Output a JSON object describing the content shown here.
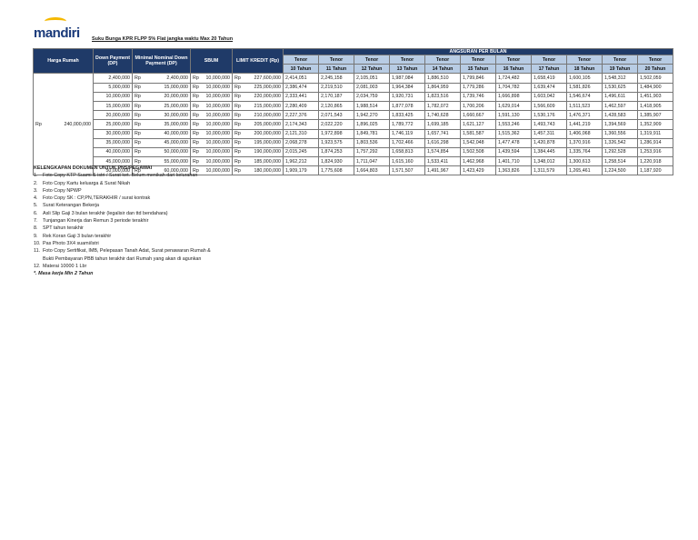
{
  "logo": "mandiri",
  "title": "Suku Bunga KPR FLPP 5% Flat  jangka waktu  Max 20 Tahun",
  "headers": {
    "harga": "Harga Rumah",
    "dp": "Down Payment (DP)",
    "min_dp": "Minimal Nominal Down Payment (DP)",
    "sbum": "SBUM",
    "limit": "LIMIT KREDIT (Rp)",
    "angsuran": "ANGSURAN PER BULAN",
    "tenor": "Tenor",
    "years": [
      "10 Tahun",
      "11 Tahun",
      "12 Tahun",
      "13 Tahun",
      "14 Tahun",
      "15 Tahun",
      "16 Tahun",
      "17 Tahun",
      "18 Tahun",
      "19 Tahun",
      "20 Tahun"
    ]
  },
  "currency": "Rp",
  "harga_rumah": "240,000,000",
  "rows": [
    {
      "dp": "2,400,000",
      "min": "2,400,000",
      "sbum": "10,000,000",
      "limit": "227,600,000",
      "a": [
        "2,414,051",
        "2,245,158",
        "2,105,051",
        "1,987,084",
        "1,886,510",
        "1,799,846",
        "1,724,482",
        "1,658,419",
        "1,600,105",
        "1,548,312",
        "1,502,059"
      ]
    },
    {
      "dp": "5,000,000",
      "min": "15,000,000",
      "sbum": "10,000,000",
      "limit": "225,000,000",
      "a": [
        "2,386,474",
        "2,219,510",
        "2,081,003",
        "1,964,384",
        "1,864,959",
        "1,779,286",
        "1,704,782",
        "1,639,474",
        "1,581,826",
        "1,530,625",
        "1,484,900"
      ]
    },
    {
      "dp": "10,000,000",
      "min": "20,000,000",
      "sbum": "10,000,000",
      "limit": "220,000,000",
      "a": [
        "2,333,441",
        "2,170,187",
        "2,034,759",
        "1,920,731",
        "1,823,516",
        "1,739,746",
        "1,666,898",
        "1,603,042",
        "1,546,674",
        "1,496,611",
        "1,451,903"
      ]
    },
    {
      "dp": "15,000,000",
      "min": "25,000,000",
      "sbum": "10,000,000",
      "limit": "215,000,000",
      "a": [
        "2,280,409",
        "2,120,865",
        "1,988,514",
        "1,877,078",
        "1,782,072",
        "1,700,206",
        "1,629,014",
        "1,566,609",
        "1,511,523",
        "1,462,597",
        "1,418,905"
      ]
    },
    {
      "dp": "20,000,000",
      "min": "30,000,000",
      "sbum": "10,000,000",
      "limit": "210,000,000",
      "a": [
        "2,227,376",
        "2,071,543",
        "1,942,270",
        "1,833,425",
        "1,740,628",
        "1,660,667",
        "1,591,130",
        "1,530,176",
        "1,476,371",
        "1,428,583",
        "1,385,907"
      ]
    },
    {
      "dp": "25,000,000",
      "min": "35,000,000",
      "sbum": "10,000,000",
      "limit": "205,000,000",
      "a": [
        "2,174,343",
        "2,022,220",
        "1,896,025",
        "1,789,772",
        "1,699,185",
        "1,621,127",
        "1,553,246",
        "1,493,743",
        "1,441,219",
        "1,394,569",
        "1,352,909"
      ]
    },
    {
      "dp": "30,000,000",
      "min": "40,000,000",
      "sbum": "10,000,000",
      "limit": "200,000,000",
      "a": [
        "2,121,310",
        "1,972,898",
        "1,849,781",
        "1,746,119",
        "1,657,741",
        "1,581,587",
        "1,515,362",
        "1,457,311",
        "1,406,068",
        "1,360,556",
        "1,319,911"
      ]
    },
    {
      "dp": "35,000,000",
      "min": "45,000,000",
      "sbum": "10,000,000",
      "limit": "195,000,000",
      "a": [
        "2,068,278",
        "1,923,575",
        "1,803,536",
        "1,702,466",
        "1,616,298",
        "1,542,048",
        "1,477,478",
        "1,420,878",
        "1,370,916",
        "1,326,542",
        "1,286,914"
      ]
    },
    {
      "dp": "40,000,000",
      "min": "50,000,000",
      "sbum": "10,000,000",
      "limit": "190,000,000",
      "a": [
        "2,015,245",
        "1,874,253",
        "1,757,292",
        "1,658,813",
        "1,574,854",
        "1,502,508",
        "1,439,594",
        "1,384,445",
        "1,335,764",
        "1,292,528",
        "1,253,916"
      ]
    },
    {
      "dp": "45,000,000",
      "min": "55,000,000",
      "sbum": "10,000,000",
      "limit": "185,000,000",
      "a": [
        "1,962,212",
        "1,824,930",
        "1,711,047",
        "1,615,160",
        "1,533,411",
        "1,462,968",
        "1,401,710",
        "1,348,012",
        "1,300,613",
        "1,258,514",
        "1,220,918"
      ]
    },
    {
      "dp": "50,000,000",
      "min": "60,000,000",
      "sbum": "10,000,000",
      "limit": "180,000,000",
      "a": [
        "1,909,179",
        "1,775,608",
        "1,664,803",
        "1,571,507",
        "1,491,967",
        "1,423,429",
        "1,363,826",
        "1,311,579",
        "1,265,461",
        "1,224,500",
        "1,187,920"
      ]
    }
  ],
  "docs": {
    "heading": "KELENGKAPAN DOKUMEN UNTUK PNS/PEGAWAI",
    "items": [
      {
        "n": "1.",
        "t": "Foto Copy KTP Suami & istri / Surat ket. Belum menikah dari kelurahan"
      },
      {
        "n": "2.",
        "t": "Foto Copy Kartu keluarga & Surat Nikah"
      },
      {
        "n": "3.",
        "t": "Foto Copy NPWP"
      },
      {
        "n": "4.",
        "t": "Foto Copy SK : CP,PN,TERAKHIR / surat kontrak"
      },
      {
        "n": "5.",
        "t": "Surat Keterangan Bekerja"
      },
      {
        "n": "6.",
        "t": "Asli Slip Gaji 3 bulan terakhir (legalisir dan ttd bendahara)"
      },
      {
        "n": "7.",
        "t": "Tunjangan Kinerja dan Remun 3 periode terakhir"
      },
      {
        "n": "8.",
        "t": "SPT tahun terakhir"
      },
      {
        "n": "9.",
        "t": "Rek Koran Gaji 3 bulan terakhir"
      },
      {
        "n": "10.",
        "t": "Pas Photo 3X4 suami/istri"
      },
      {
        "n": "11.",
        "t": "Foto Copy Sertifikat, IMB, Pelepasan Tanah Adat, Surat penawaran Rumah &"
      },
      {
        "n": "",
        "t": "Bukti Pembayaran PBB tahun terakhir dari Rumah yang akan di agunkan"
      },
      {
        "n": "12.",
        "t": "Materai 10000 1 Lbr"
      }
    ],
    "note": "*.  Masa kerja Min 2 Tahun"
  }
}
